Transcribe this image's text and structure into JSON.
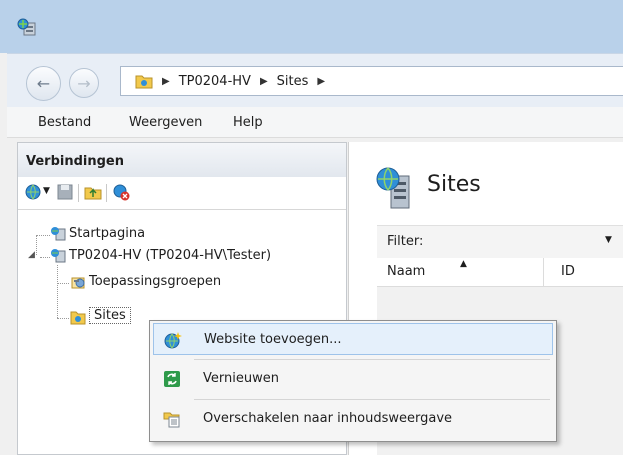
{
  "addressbar": {
    "crumbs": [
      "TP0204-HV",
      "Sites"
    ]
  },
  "menu": {
    "items": [
      "Bestand",
      "Weergeven",
      "Help"
    ]
  },
  "connections": {
    "title": "Verbindingen",
    "tree": {
      "start": "Startpagina",
      "server": "TP0204-HV (TP0204-HV\\Tester)",
      "apppools": "Toepassingsgroepen",
      "sites": "Sites"
    }
  },
  "main": {
    "heading": "Sites",
    "filter_label": "Filter:",
    "columns": [
      "Naam",
      "ID"
    ]
  },
  "context_menu": {
    "items": [
      "Website toevoegen...",
      "Vernieuwen",
      "Overschakelen naar inhoudsweergave"
    ]
  },
  "colors": {
    "titlebar": "#b9d1ea",
    "highlight": "#e5f0fb",
    "highlight_border": "#9ec3ea"
  }
}
